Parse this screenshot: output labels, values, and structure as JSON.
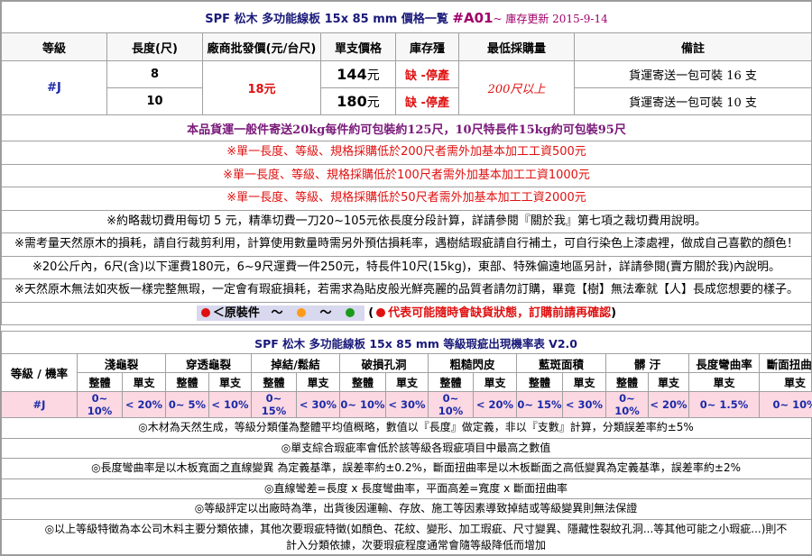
{
  "header": {
    "title_prefix": "SPF 松木 多功能線板",
    "title_size": "15x 85 mm",
    "title_suffix": "價格一覧",
    "code": "#A01",
    "update": "~ 庫存更新 2015-9-14"
  },
  "price_table": {
    "columns": [
      "等級",
      "長度(尺)",
      "廠商批發價(元/台尺)",
      "單支價格",
      "庫存殭",
      "最低採購量",
      "備註"
    ],
    "grade": "#J",
    "wholesale": "18元",
    "min_order": "200尺以上",
    "rows": [
      {
        "length": "8",
        "price": "144",
        "price_unit": "元",
        "stock": "缺 -停產",
        "note": "貨運寄送一包可裝 16 支"
      },
      {
        "length": "10",
        "price": "180",
        "price_unit": "元",
        "stock": "缺 -停產",
        "note": "貨運寄送一包可裝 10 支"
      }
    ]
  },
  "shipping_note": "本品貨運一般件寄送20kg每件約可包裝約125尺，10尺特長件15kg約可包裝95尺",
  "notes": {
    "n1": "※單一長度、等級、規格採購低於200尺者需外加基本加工工資500元",
    "n2": "※單一長度、等級、規格採購低於100尺者需外加基本加工工資1000元",
    "n3": "※單一長度、等級、規格採購低於50尺者需外加基本加工工資2000元",
    "n4": "※約略裁切費用每切 5 元，精準切費一刀20~105元依長度分段計算，詳請參閱『關於我』第七項之裁切費用說明。",
    "n5": "※需考量天然原木的損耗，請自行裁剪利用，計算使用數量時需另外預估損耗率，遇樹結瑕疵請自行補土，可自行染色上漆處裡，做成自己喜歡的顏色！",
    "n6": "※20公斤內，6尺(含)以下運費180元，6~9尺運費一件250元，特長件10尺(15kg)，東部、特殊偏遠地區另計，詳請參閱(賣方關於我)內說明。",
    "n7": "※天然原木無法如夾板一樣完整無瑕，一定會有瑕疵損耗，若需求為貼皮般光鮮亮麗的品質者請勿訂購，畢竟【樹】無法牽就【人】長成您想要的樣子。"
  },
  "legend": {
    "label": "＜原裝件",
    "sep1": "～",
    "sep2": "～",
    "paren_open": "(",
    "warning": "代表可能隨時會缺貨狀態，訂購前請再確認",
    "paren_close": ")"
  },
  "defect_table": {
    "title_prefix": "SPF 松木 多功能線板",
    "title_size": "15x 85 mm",
    "title_suffix": "等級瑕疵出現機率表 V2.0",
    "grade_header": "等級 / 機率",
    "categories": [
      "淺龜裂",
      "穿透龜裂",
      "掉結/鬆結",
      "破損孔洞",
      "粗糙閃皮",
      "藍斑面積",
      "髒 汙",
      "長度彎曲率",
      "斷面扭曲率"
    ],
    "sub_whole": "整體",
    "sub_single": "單支",
    "grade": "#J",
    "values": [
      "0~ 10%",
      "< 20%",
      "0~ 5%",
      "< 10%",
      "0~ 15%",
      "< 30%",
      "0~ 10%",
      "< 30%",
      "0~ 10%",
      "< 20%",
      "0~ 15%",
      "< 30%",
      "0~ 10%",
      "< 20%",
      "0~ 1.5%",
      "0~ 10%"
    ]
  },
  "footnotes": {
    "f1": "◎木材為天然生成，等級分類僅為整體平均值概略，數值以『長度』做定義，非以『支數』計算，分類誤差率約±5%",
    "f2": "◎單支綜合瑕疵率會低於該等級各瑕疵項目中最高之數值",
    "f3": "◎長度彎曲率是以木板寬面之直線變異 為定義基準，誤差率約±0.2%，斷面扭曲率是以木板斷面之高低變異為定義基準，誤差率約±2%",
    "f4": "◎直線彎差=長度 x 長度彎曲率，平面高差=寬度 x 斷面扭曲率",
    "f5": "◎等級評定以出廠時為準，出貨後因運輸、存放、施工等因素導致掉結或等級變異則無法保證",
    "f6": "◎以上等級特徵為本公司木料主要分類依據，其他次要瑕疵特徵(如顏色、花紋、變形、加工瑕疵、尺寸變異、隱藏性裂紋孔洞...等其他可能之小瑕疵...)則不",
    "f7": "計入分類依據，次要瑕疵程度通常會隨等級降低而增加"
  },
  "colors": {
    "red_dot": "#e01010",
    "orange_dot": "#ff9a1a",
    "blue_dot": "#2a6ad8",
    "green_dot": "#1a9a1a",
    "pink_row": "#fbd8e2",
    "title_blue": "#1a1a7a",
    "code_magenta": "#a0006a"
  }
}
